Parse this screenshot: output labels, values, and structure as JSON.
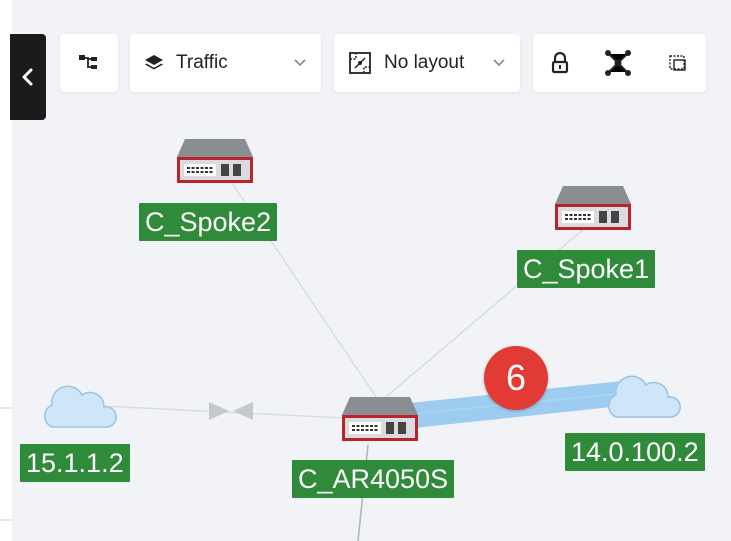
{
  "toolbar": {
    "view_mode": {
      "label": "Traffic",
      "icon": "layers-icon"
    },
    "layout_mode": {
      "label": "No layout",
      "icon": "layout-grid-icon"
    },
    "icons": [
      "tree-structure-icon",
      "lock-icon",
      "topology-icon",
      "select-area-icon",
      "chevron-left-icon"
    ]
  },
  "nodes": {
    "spoke2": {
      "label": "C_Spoke2",
      "kind": "router"
    },
    "spoke1": {
      "label": "C_Spoke1",
      "kind": "router"
    },
    "hub": {
      "label": "C_AR4050S",
      "kind": "router"
    },
    "cloud_left": {
      "label": "15.1.1.2",
      "kind": "cloud"
    },
    "cloud_right": {
      "label": "14.0.100.2",
      "kind": "cloud"
    }
  },
  "link_badge": {
    "value": "6"
  },
  "colors": {
    "label_green": "#2f8a3a",
    "badge_red": "#e23b35",
    "highlight_link": "#8ec4ee",
    "device_red": "#b8242b"
  }
}
